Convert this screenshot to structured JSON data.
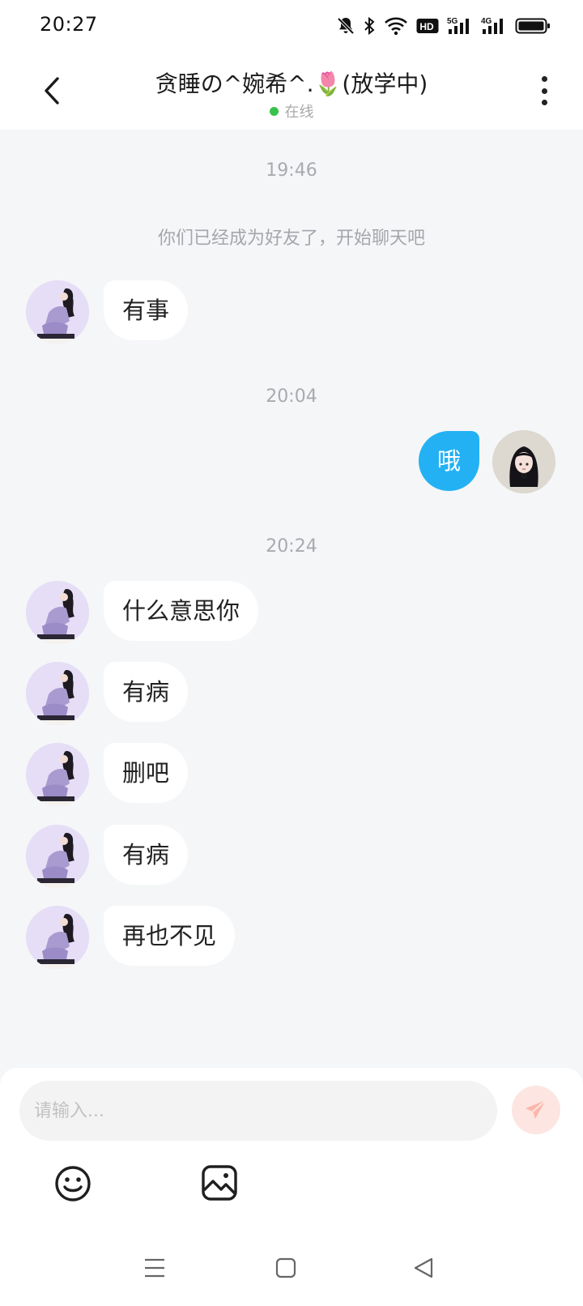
{
  "status_bar": {
    "time": "20:27",
    "icons": [
      "bell-muted-icon",
      "bluetooth-icon",
      "wifi-icon",
      "hd-icon",
      "signal-5g-icon",
      "signal-4g-icon",
      "battery-icon"
    ],
    "hd_label": "HD",
    "net1_label": "5G",
    "net2_label": "4G"
  },
  "header": {
    "title": "贪睡の^婉希^.🌷(放学中)",
    "status": "在线",
    "status_color": "#37c24b"
  },
  "messages": [
    {
      "type": "time",
      "text": "19:46"
    },
    {
      "type": "system",
      "text": "你们已经成为好友了，开始聊天吧"
    },
    {
      "type": "incoming",
      "text": "有事"
    },
    {
      "type": "time",
      "text": "20:04"
    },
    {
      "type": "outgoing",
      "text": "哦"
    },
    {
      "type": "time",
      "text": "20:24"
    },
    {
      "type": "incoming",
      "text": "什么意思你"
    },
    {
      "type": "incoming",
      "text": "有病"
    },
    {
      "type": "incoming",
      "text": "删吧"
    },
    {
      "type": "incoming",
      "text": "有病"
    },
    {
      "type": "incoming",
      "text": "再也不见"
    }
  ],
  "composer": {
    "placeholder": "请输入...",
    "send_icon": "paper-plane-icon",
    "send_color": "#fde5e1"
  },
  "toolbar": {
    "emoji_icon": "smiley-icon",
    "image_icon": "image-icon"
  },
  "nav": {
    "icons": [
      "menu-icon",
      "home-icon",
      "back-triangle-icon"
    ]
  },
  "colors": {
    "outgoing_bubble": "#23b1f4",
    "incoming_bubble": "#ffffff",
    "background": "#f5f6f8"
  }
}
